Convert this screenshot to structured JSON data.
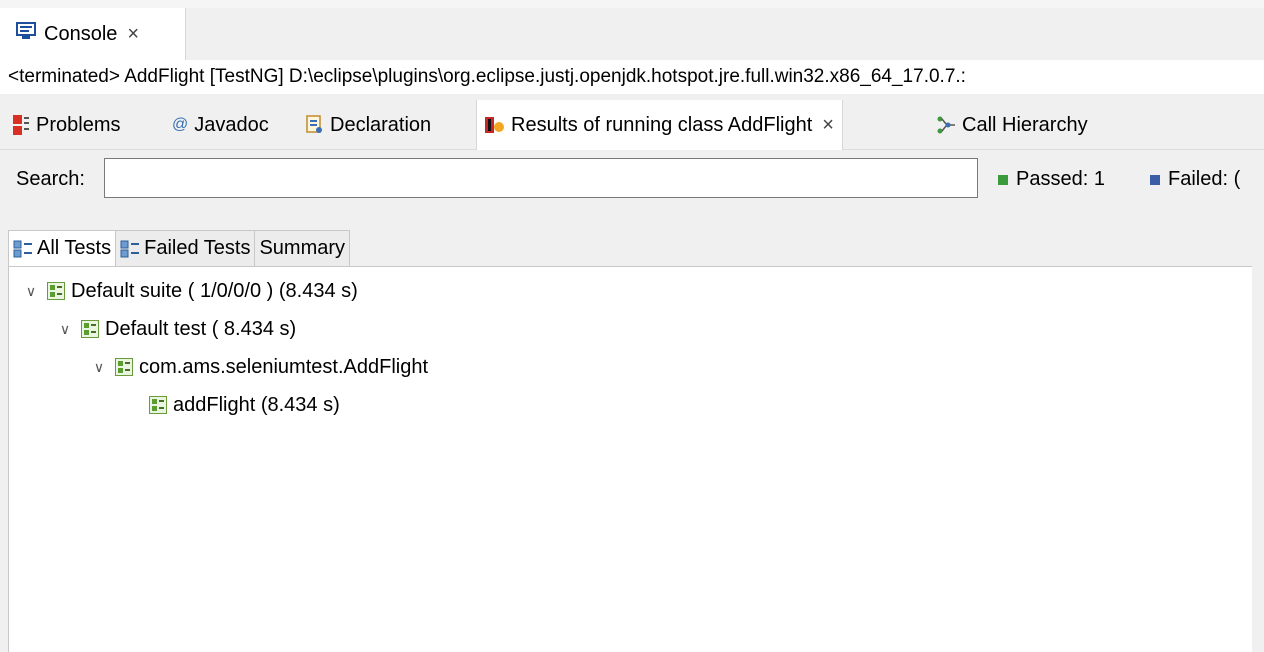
{
  "console": {
    "tab_label": "Console",
    "close_glyph": "×",
    "icon": "console-monitor-icon",
    "status_line": "<terminated> AddFlight [TestNG] D:\\eclipse\\plugins\\org.eclipse.justj.openjdk.hotspot.jre.full.win32.x86_64_17.0.7.:"
  },
  "views": {
    "tabs": [
      {
        "label": "Problems",
        "icon": "problems-icon"
      },
      {
        "label": "Javadoc",
        "icon": "javadoc-at-icon"
      },
      {
        "label": "Declaration",
        "icon": "declaration-icon"
      },
      {
        "label": "Results of running class AddFlight",
        "icon": "testng-icon",
        "active": true
      },
      {
        "label": "Call Hierarchy",
        "icon": "call-hierarchy-icon"
      }
    ],
    "close_glyph": "×"
  },
  "search": {
    "label": "Search:",
    "value": "",
    "placeholder": ""
  },
  "stats": {
    "passed_label": "Passed: 1",
    "failed_label": "Failed: (",
    "passed_color": "#3c9a3c",
    "failed_color": "#3b5fa6"
  },
  "subtabs": [
    {
      "label": "All Tests",
      "icon": "tests-tree-icon",
      "active": true
    },
    {
      "label": "Failed Tests",
      "icon": "tests-tree-icon",
      "active": false
    },
    {
      "label": "Summary",
      "active": false
    }
  ],
  "tree": [
    {
      "label": "Default suite ( 1/0/0/0 ) (8.434 s)",
      "expanded": true,
      "level": 0
    },
    {
      "label": "Default test ( 8.434 s)",
      "expanded": true,
      "level": 1
    },
    {
      "label": "com.ams.seleniumtest.AddFlight",
      "expanded": true,
      "level": 2
    },
    {
      "label": "addFlight  (8.434 s)",
      "expanded": null,
      "level": 3
    }
  ]
}
